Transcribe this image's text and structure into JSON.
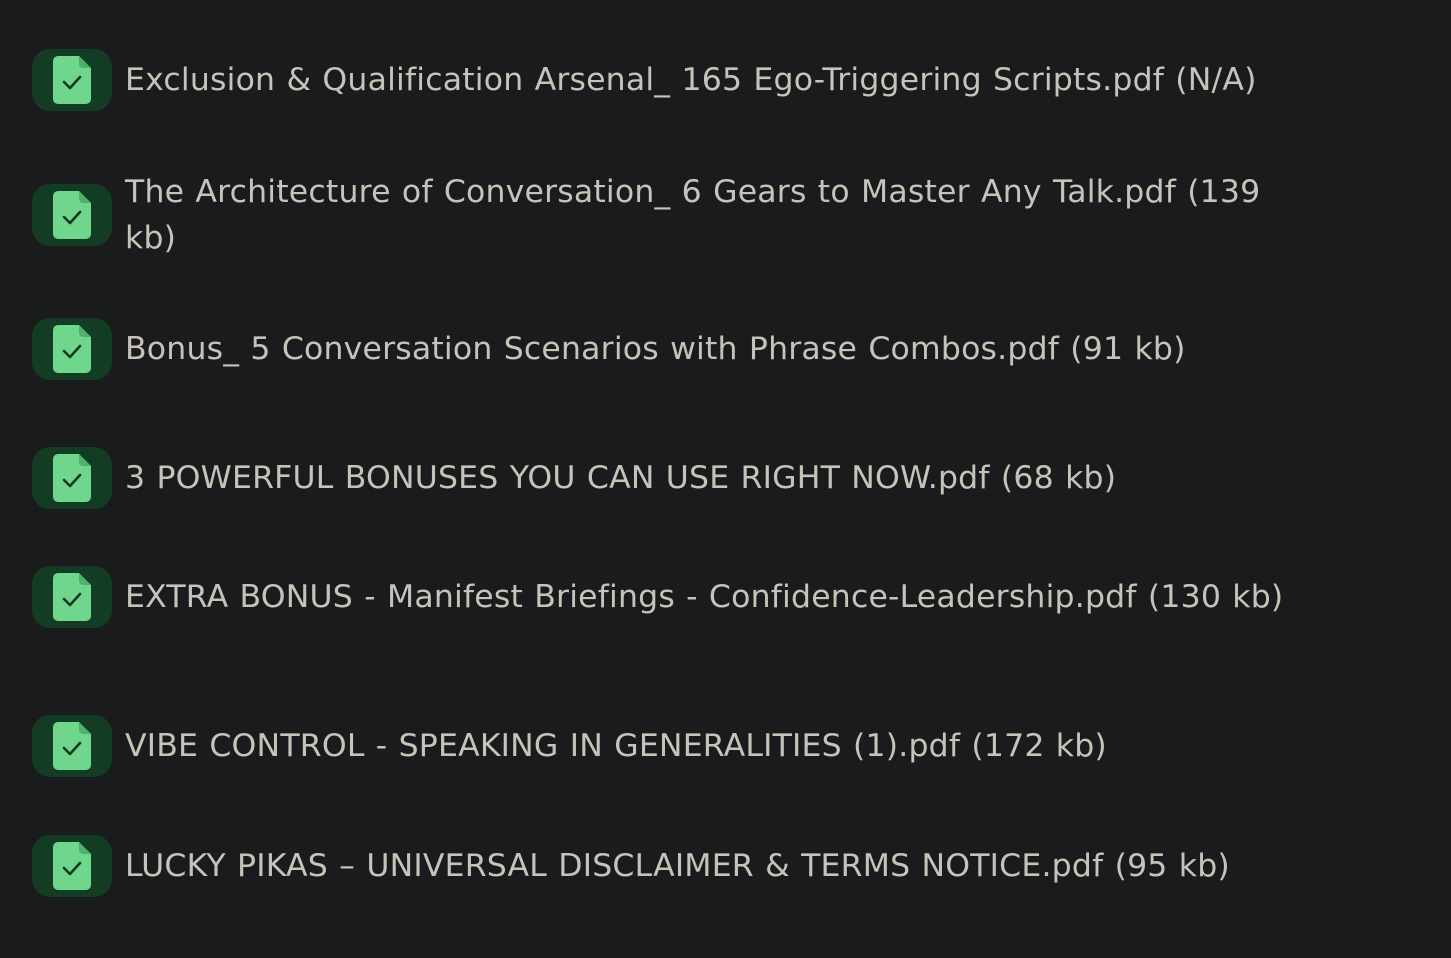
{
  "colors": {
    "background": "#1a1b1d",
    "icon_badge": "#123c23",
    "icon_fill": "#6fd68b",
    "icon_check": "#0f3a20",
    "text": "#c8c3b8"
  },
  "icon": "file-check-icon",
  "files": [
    {
      "label": "Exclusion & Qualification Arsenal_ 165 Ego-Triggering Scripts.pdf (N/A)"
    },
    {
      "label": "The Architecture of Conversation_ 6 Gears to Master Any Talk.pdf (139 kb)"
    },
    {
      "label": "Bonus_ 5 Conversation Scenarios with Phrase Combos.pdf (91 kb)"
    },
    {
      "label": "3 POWERFUL BONUSES YOU CAN USE RIGHT NOW.pdf (68 kb)"
    },
    {
      "label": "EXTRA BONUS - Manifest Briefings - Confidence-Leadership.pdf (130 kb)"
    },
    {
      "label": "VIBE CONTROL - SPEAKING IN GENERALITIES (1).pdf (172 kb)"
    },
    {
      "label": "LUCKY PIKAS – UNIVERSAL DISCLAIMER & TERMS NOTICE.pdf (95 kb)"
    }
  ]
}
